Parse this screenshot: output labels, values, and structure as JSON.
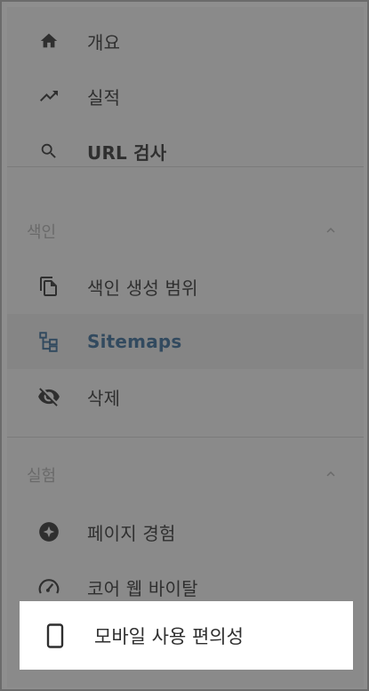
{
  "nav": {
    "items": [
      {
        "label": "개요",
        "icon": "home-icon"
      },
      {
        "label": "실적",
        "icon": "trending-up-icon"
      },
      {
        "label": "URL 검사",
        "icon": "search-icon"
      }
    ],
    "sections": [
      {
        "title": "색인",
        "items": [
          {
            "label": "색인 생성 범위",
            "icon": "copy-icon"
          },
          {
            "label": "Sitemaps",
            "icon": "sitemap-icon"
          },
          {
            "label": "삭제",
            "icon": "visibility-off-icon"
          }
        ]
      },
      {
        "title": "실험",
        "items": [
          {
            "label": "페이지 경험",
            "icon": "page-experience-icon"
          },
          {
            "label": "코어 웹 바이탈",
            "icon": "speedometer-icon"
          },
          {
            "label": "모바일 사용 편의성",
            "icon": "phone-icon"
          }
        ]
      }
    ]
  },
  "colors": {
    "overlay": "#8a8a8a",
    "selected_bg": "#858585",
    "selected_text": "#324a5f",
    "highlight_bg": "#ffffff",
    "text": "#2f2f2f"
  }
}
